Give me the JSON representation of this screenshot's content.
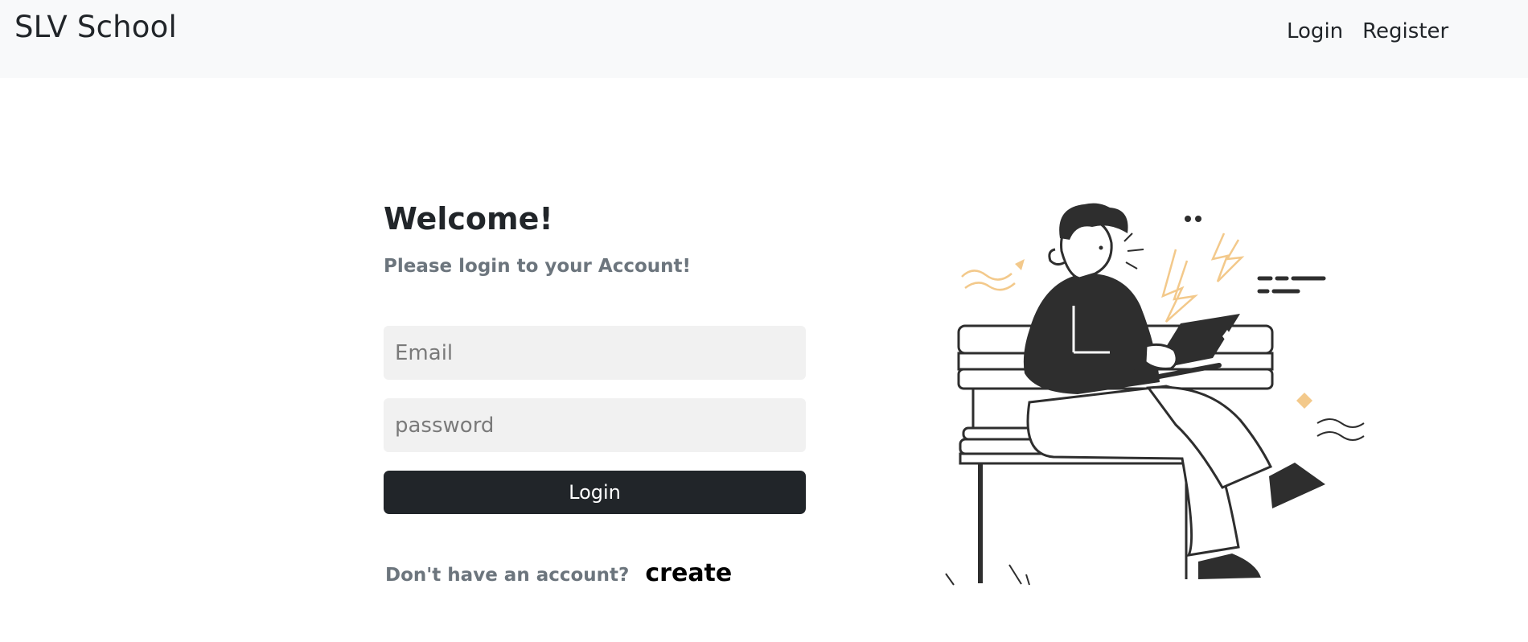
{
  "navbar": {
    "brand": "SLV School",
    "links": [
      {
        "label": "Login"
      },
      {
        "label": "Register"
      }
    ]
  },
  "form": {
    "title": "Welcome!",
    "subtitle": "Please login to your Account!",
    "email_placeholder": "Email",
    "password_placeholder": "password",
    "submit_label": "Login",
    "signup_prompt": "Don't have an account?",
    "signup_link": "create"
  },
  "illustration": {
    "icon": "person-on-bench-with-laptop",
    "ink_color": "#2e2e2e",
    "accent_color": "#f3c98b"
  }
}
